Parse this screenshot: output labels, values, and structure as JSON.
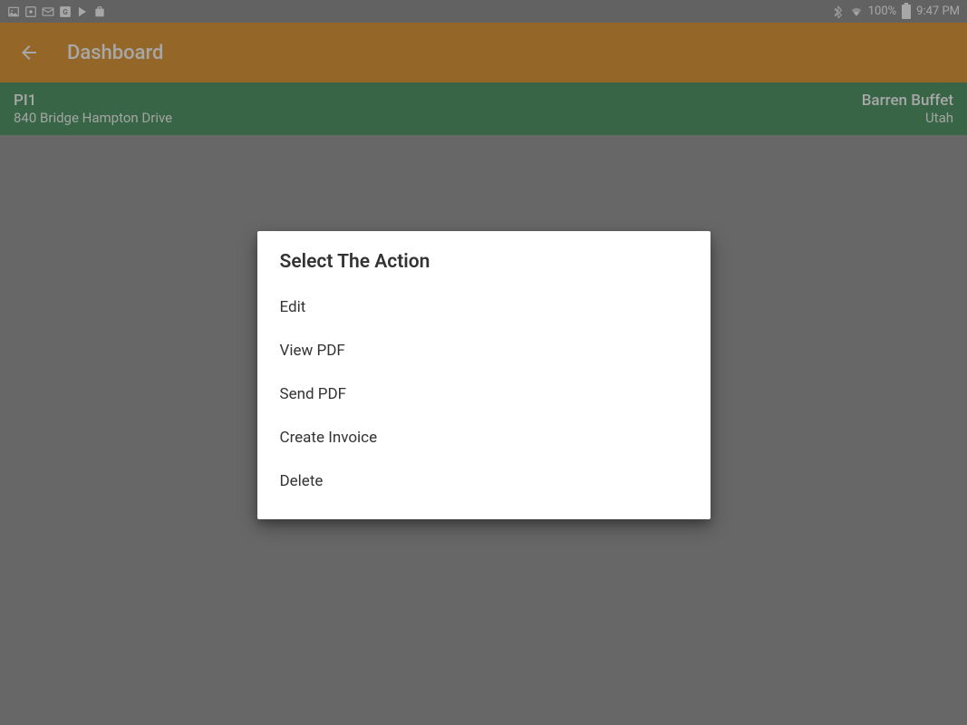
{
  "status": {
    "battery": "100%",
    "time": "9:47 PM"
  },
  "appbar": {
    "title": "Dashboard"
  },
  "record": {
    "code": "PI1",
    "address": "840 Bridge Hampton Drive",
    "customer": "Barren Buffet",
    "region": "Utah"
  },
  "dialog": {
    "title": "Select The Action",
    "items": [
      "Edit",
      "View PDF",
      "Send PDF",
      "Create Invoice",
      "Delete"
    ]
  }
}
